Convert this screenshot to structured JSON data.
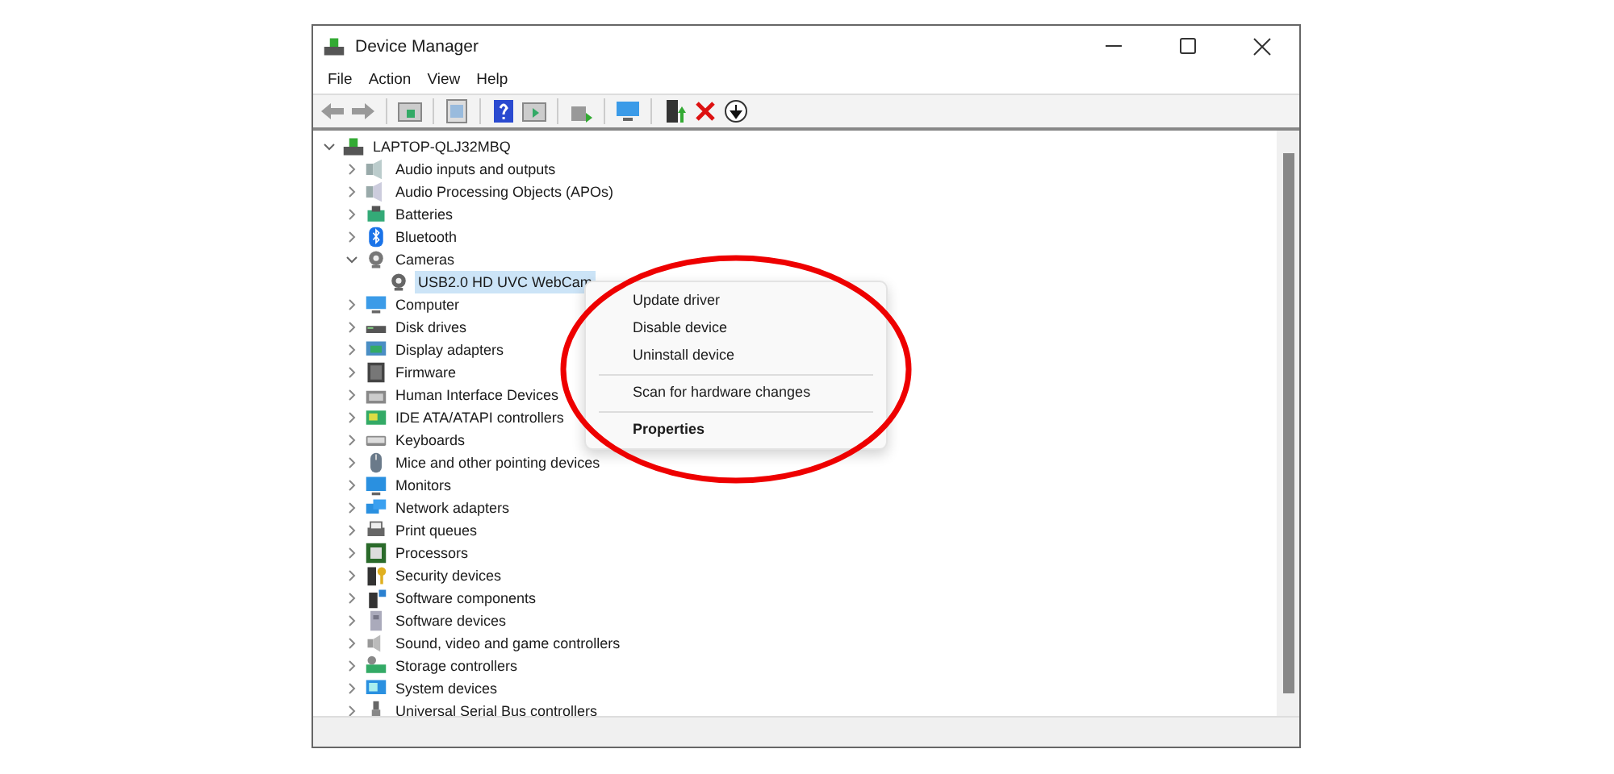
{
  "window": {
    "title": "Device Manager"
  },
  "menu_bar": [
    "File",
    "Action",
    "View",
    "Help"
  ],
  "tree": {
    "label": "LAPTOP-QLJ32MBQ",
    "expanded": true,
    "selected": false,
    "children": [
      {
        "label": "Audio inputs and outputs",
        "expanded": false,
        "selected": false
      },
      {
        "label": "Audio Processing Objects (APOs)",
        "expanded": false,
        "selected": false
      },
      {
        "label": "Batteries",
        "expanded": false,
        "selected": false
      },
      {
        "label": "Bluetooth",
        "expanded": false,
        "selected": false
      },
      {
        "label": "Cameras",
        "expanded": true,
        "selected": false,
        "children": [
          {
            "label": "USB2.0 HD UVC WebCam",
            "selected": true
          }
        ]
      },
      {
        "label": "Computer",
        "expanded": false,
        "selected": false
      },
      {
        "label": "Disk drives",
        "expanded": false,
        "selected": false
      },
      {
        "label": "Display adapters",
        "expanded": false,
        "selected": false
      },
      {
        "label": "Firmware",
        "expanded": false,
        "selected": false
      },
      {
        "label": "Human Interface Devices",
        "expanded": false,
        "selected": false
      },
      {
        "label": "IDE ATA/ATAPI controllers",
        "expanded": false,
        "selected": false
      },
      {
        "label": "Keyboards",
        "expanded": false,
        "selected": false
      },
      {
        "label": "Mice and other pointing devices",
        "expanded": false,
        "selected": false
      },
      {
        "label": "Monitors",
        "expanded": false,
        "selected": false
      },
      {
        "label": "Network adapters",
        "expanded": false,
        "selected": false
      },
      {
        "label": "Print queues",
        "expanded": false,
        "selected": false
      },
      {
        "label": "Processors",
        "expanded": false,
        "selected": false
      },
      {
        "label": "Security devices",
        "expanded": false,
        "selected": false
      },
      {
        "label": "Software components",
        "expanded": false,
        "selected": false
      },
      {
        "label": "Software devices",
        "expanded": false,
        "selected": false
      },
      {
        "label": "Sound, video and game controllers",
        "expanded": false,
        "selected": false
      },
      {
        "label": "Storage controllers",
        "expanded": false,
        "selected": false
      },
      {
        "label": "System devices",
        "expanded": false,
        "selected": false
      },
      {
        "label": "Universal Serial Bus controllers",
        "expanded": false,
        "selected": false
      }
    ]
  },
  "context_menu": {
    "items": [
      {
        "label": "Update driver",
        "separator_before": false,
        "default": false
      },
      {
        "label": "Disable device",
        "separator_before": false,
        "default": false
      },
      {
        "label": "Uninstall device",
        "separator_before": false,
        "default": false
      },
      {
        "label": "Scan for hardware changes",
        "separator_before": true,
        "default": false
      },
      {
        "label": "Properties",
        "separator_before": true,
        "default": true
      }
    ]
  }
}
